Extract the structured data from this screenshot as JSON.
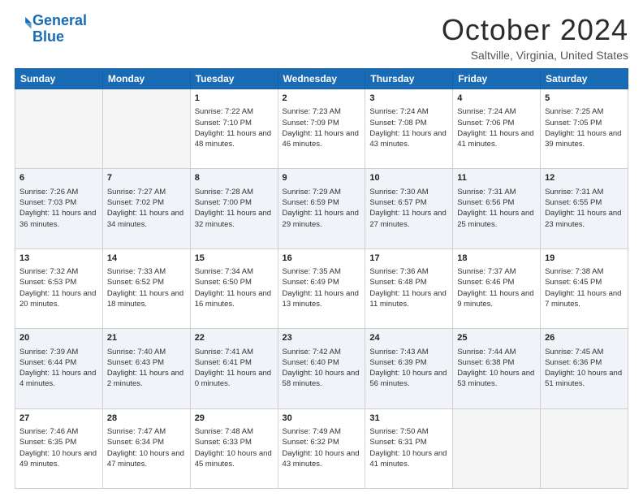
{
  "logo": {
    "line1": "General",
    "line2": "Blue"
  },
  "title": "October 2024",
  "subtitle": "Saltville, Virginia, United States",
  "days_header": [
    "Sunday",
    "Monday",
    "Tuesday",
    "Wednesday",
    "Thursday",
    "Friday",
    "Saturday"
  ],
  "weeks": [
    [
      {
        "day": "",
        "sunrise": "",
        "sunset": "",
        "daylight": ""
      },
      {
        "day": "",
        "sunrise": "",
        "sunset": "",
        "daylight": ""
      },
      {
        "day": "1",
        "sunrise": "Sunrise: 7:22 AM",
        "sunset": "Sunset: 7:10 PM",
        "daylight": "Daylight: 11 hours and 48 minutes."
      },
      {
        "day": "2",
        "sunrise": "Sunrise: 7:23 AM",
        "sunset": "Sunset: 7:09 PM",
        "daylight": "Daylight: 11 hours and 46 minutes."
      },
      {
        "day": "3",
        "sunrise": "Sunrise: 7:24 AM",
        "sunset": "Sunset: 7:08 PM",
        "daylight": "Daylight: 11 hours and 43 minutes."
      },
      {
        "day": "4",
        "sunrise": "Sunrise: 7:24 AM",
        "sunset": "Sunset: 7:06 PM",
        "daylight": "Daylight: 11 hours and 41 minutes."
      },
      {
        "day": "5",
        "sunrise": "Sunrise: 7:25 AM",
        "sunset": "Sunset: 7:05 PM",
        "daylight": "Daylight: 11 hours and 39 minutes."
      }
    ],
    [
      {
        "day": "6",
        "sunrise": "Sunrise: 7:26 AM",
        "sunset": "Sunset: 7:03 PM",
        "daylight": "Daylight: 11 hours and 36 minutes."
      },
      {
        "day": "7",
        "sunrise": "Sunrise: 7:27 AM",
        "sunset": "Sunset: 7:02 PM",
        "daylight": "Daylight: 11 hours and 34 minutes."
      },
      {
        "day": "8",
        "sunrise": "Sunrise: 7:28 AM",
        "sunset": "Sunset: 7:00 PM",
        "daylight": "Daylight: 11 hours and 32 minutes."
      },
      {
        "day": "9",
        "sunrise": "Sunrise: 7:29 AM",
        "sunset": "Sunset: 6:59 PM",
        "daylight": "Daylight: 11 hours and 29 minutes."
      },
      {
        "day": "10",
        "sunrise": "Sunrise: 7:30 AM",
        "sunset": "Sunset: 6:57 PM",
        "daylight": "Daylight: 11 hours and 27 minutes."
      },
      {
        "day": "11",
        "sunrise": "Sunrise: 7:31 AM",
        "sunset": "Sunset: 6:56 PM",
        "daylight": "Daylight: 11 hours and 25 minutes."
      },
      {
        "day": "12",
        "sunrise": "Sunrise: 7:31 AM",
        "sunset": "Sunset: 6:55 PM",
        "daylight": "Daylight: 11 hours and 23 minutes."
      }
    ],
    [
      {
        "day": "13",
        "sunrise": "Sunrise: 7:32 AM",
        "sunset": "Sunset: 6:53 PM",
        "daylight": "Daylight: 11 hours and 20 minutes."
      },
      {
        "day": "14",
        "sunrise": "Sunrise: 7:33 AM",
        "sunset": "Sunset: 6:52 PM",
        "daylight": "Daylight: 11 hours and 18 minutes."
      },
      {
        "day": "15",
        "sunrise": "Sunrise: 7:34 AM",
        "sunset": "Sunset: 6:50 PM",
        "daylight": "Daylight: 11 hours and 16 minutes."
      },
      {
        "day": "16",
        "sunrise": "Sunrise: 7:35 AM",
        "sunset": "Sunset: 6:49 PM",
        "daylight": "Daylight: 11 hours and 13 minutes."
      },
      {
        "day": "17",
        "sunrise": "Sunrise: 7:36 AM",
        "sunset": "Sunset: 6:48 PM",
        "daylight": "Daylight: 11 hours and 11 minutes."
      },
      {
        "day": "18",
        "sunrise": "Sunrise: 7:37 AM",
        "sunset": "Sunset: 6:46 PM",
        "daylight": "Daylight: 11 hours and 9 minutes."
      },
      {
        "day": "19",
        "sunrise": "Sunrise: 7:38 AM",
        "sunset": "Sunset: 6:45 PM",
        "daylight": "Daylight: 11 hours and 7 minutes."
      }
    ],
    [
      {
        "day": "20",
        "sunrise": "Sunrise: 7:39 AM",
        "sunset": "Sunset: 6:44 PM",
        "daylight": "Daylight: 11 hours and 4 minutes."
      },
      {
        "day": "21",
        "sunrise": "Sunrise: 7:40 AM",
        "sunset": "Sunset: 6:43 PM",
        "daylight": "Daylight: 11 hours and 2 minutes."
      },
      {
        "day": "22",
        "sunrise": "Sunrise: 7:41 AM",
        "sunset": "Sunset: 6:41 PM",
        "daylight": "Daylight: 11 hours and 0 minutes."
      },
      {
        "day": "23",
        "sunrise": "Sunrise: 7:42 AM",
        "sunset": "Sunset: 6:40 PM",
        "daylight": "Daylight: 10 hours and 58 minutes."
      },
      {
        "day": "24",
        "sunrise": "Sunrise: 7:43 AM",
        "sunset": "Sunset: 6:39 PM",
        "daylight": "Daylight: 10 hours and 56 minutes."
      },
      {
        "day": "25",
        "sunrise": "Sunrise: 7:44 AM",
        "sunset": "Sunset: 6:38 PM",
        "daylight": "Daylight: 10 hours and 53 minutes."
      },
      {
        "day": "26",
        "sunrise": "Sunrise: 7:45 AM",
        "sunset": "Sunset: 6:36 PM",
        "daylight": "Daylight: 10 hours and 51 minutes."
      }
    ],
    [
      {
        "day": "27",
        "sunrise": "Sunrise: 7:46 AM",
        "sunset": "Sunset: 6:35 PM",
        "daylight": "Daylight: 10 hours and 49 minutes."
      },
      {
        "day": "28",
        "sunrise": "Sunrise: 7:47 AM",
        "sunset": "Sunset: 6:34 PM",
        "daylight": "Daylight: 10 hours and 47 minutes."
      },
      {
        "day": "29",
        "sunrise": "Sunrise: 7:48 AM",
        "sunset": "Sunset: 6:33 PM",
        "daylight": "Daylight: 10 hours and 45 minutes."
      },
      {
        "day": "30",
        "sunrise": "Sunrise: 7:49 AM",
        "sunset": "Sunset: 6:32 PM",
        "daylight": "Daylight: 10 hours and 43 minutes."
      },
      {
        "day": "31",
        "sunrise": "Sunrise: 7:50 AM",
        "sunset": "Sunset: 6:31 PM",
        "daylight": "Daylight: 10 hours and 41 minutes."
      },
      {
        "day": "",
        "sunrise": "",
        "sunset": "",
        "daylight": ""
      },
      {
        "day": "",
        "sunrise": "",
        "sunset": "",
        "daylight": ""
      }
    ]
  ]
}
